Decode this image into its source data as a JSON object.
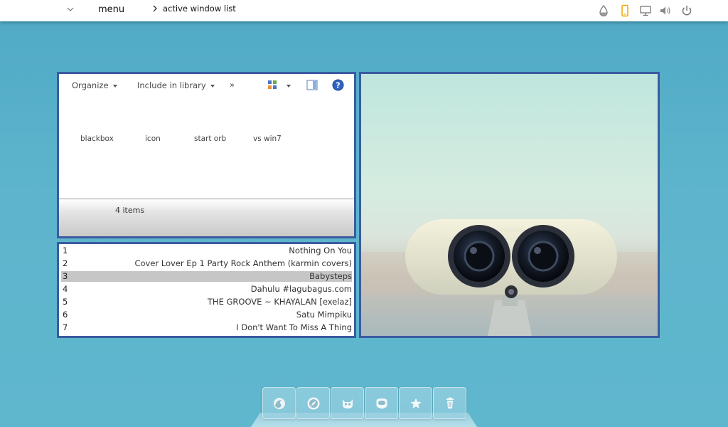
{
  "topbar": {
    "menu_label": "menu",
    "active_window_label": "active window list",
    "tray_icons": [
      "droplet-icon",
      "phone-icon",
      "monitor-icon",
      "volume-icon",
      "power-icon"
    ]
  },
  "explorer": {
    "toolbar": {
      "organize": "Organize",
      "include_in_library": "Include in library",
      "more": "»"
    },
    "files": [
      "blackbox",
      "icon",
      "start orb",
      "vs win7"
    ],
    "status": "4 items"
  },
  "playlist": {
    "active_index": 2,
    "tracks": [
      {
        "num": "1",
        "title": "Nothing On You"
      },
      {
        "num": "2",
        "title": "Cover Lover Ep 1 Party Rock Anthem (karmin covers)"
      },
      {
        "num": "3",
        "title": "Babysteps"
      },
      {
        "num": "4",
        "title": "Dahulu #lagubagus.com"
      },
      {
        "num": "5",
        "title": "THE GROOVE ~ KHAYALAN [exelaz]"
      },
      {
        "num": "6",
        "title": "Satu Mimpiku"
      },
      {
        "num": "7",
        "title": "I Don't Want To Miss A Thing"
      }
    ]
  },
  "dock": {
    "items": [
      "firefox-icon",
      "safari-icon",
      "gimp-icon",
      "finder-icon",
      "star-icon",
      "trash-icon"
    ]
  },
  "colors": {
    "frame_border": "#3b5ba0",
    "desktop_blue": "#5db4cc",
    "tray_accent": "#f0a500"
  }
}
